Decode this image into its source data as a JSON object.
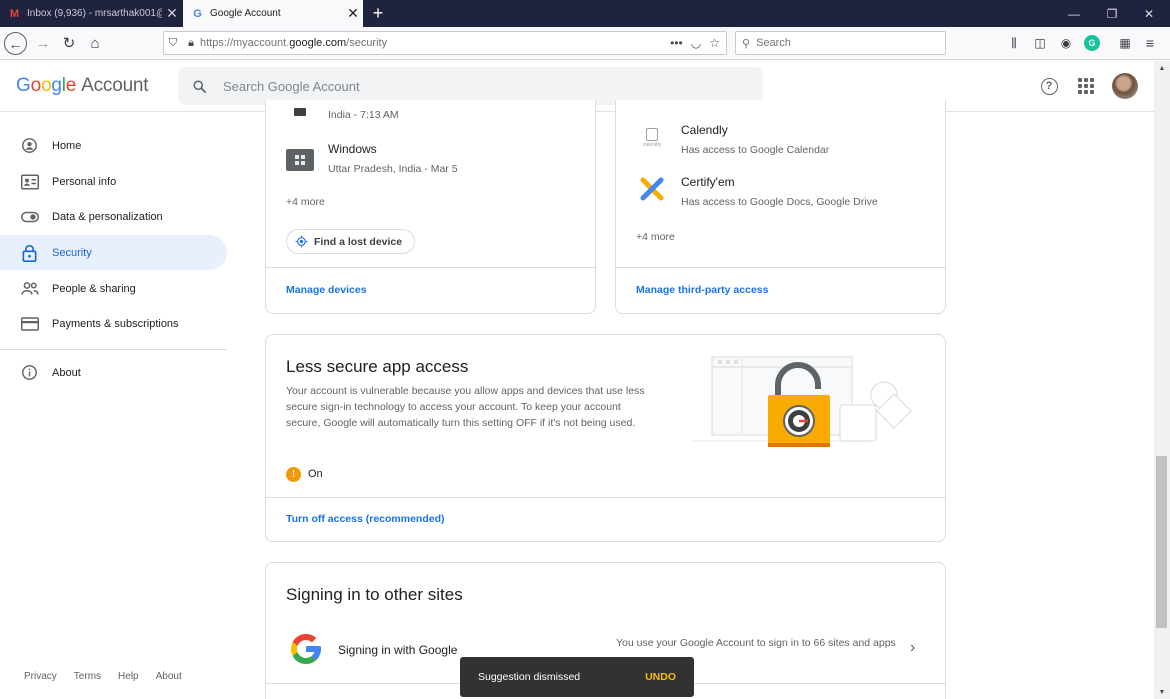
{
  "browser": {
    "tabs": [
      {
        "title": "Inbox (9,936) - mrsarthak001@",
        "icon": "gmail-icon"
      },
      {
        "title": "Google Account",
        "icon": "google-g-icon"
      }
    ],
    "url": {
      "prefix": "https://myaccount.",
      "host": "google.com",
      "path": "/security"
    },
    "search_placeholder": "Search"
  },
  "header": {
    "logo": {
      "g": "G",
      "o1": "o",
      "o2": "o",
      "g2": "g",
      "l": "l",
      "e": "e",
      "account": "Account"
    },
    "search_placeholder": "Search Google Account"
  },
  "sidebar": {
    "items": [
      {
        "label": "Home",
        "icon": "home-icon"
      },
      {
        "label": "Personal info",
        "icon": "personal-info-icon"
      },
      {
        "label": "Data & personalization",
        "icon": "toggle-icon"
      },
      {
        "label": "Security",
        "icon": "lock-icon"
      },
      {
        "label": "People & sharing",
        "icon": "people-icon"
      },
      {
        "label": "Payments & subscriptions",
        "icon": "card-icon"
      },
      {
        "label": "About",
        "icon": "info-icon"
      }
    ],
    "footer": [
      "Privacy",
      "Terms",
      "Help",
      "About"
    ]
  },
  "devices_card": {
    "partial_text": "India - 7:13 AM",
    "device": {
      "name": "Windows",
      "detail": "Uttar Pradesh, India - Mar 5"
    },
    "more": "+4 more",
    "find_button": "Find a lost device",
    "manage_link": "Manage devices"
  },
  "third_party_card": {
    "apps": [
      {
        "name": "Calendly",
        "detail": "Has access to Google Calendar"
      },
      {
        "name": "Certify'em",
        "detail": "Has access to Google Docs, Google Drive"
      }
    ],
    "more": "+4 more",
    "manage_link": "Manage third-party access"
  },
  "less_secure_card": {
    "title": "Less secure app access",
    "description": "Your account is vulnerable because you allow apps and devices that use less secure sign-in technology to access your account. To keep your account secure, Google will automatically turn this setting OFF if it's not being used.",
    "status": "On",
    "action_link": "Turn off access (recommended)",
    "colors": {
      "warning": "#f29900",
      "lock": "#f9ab00"
    }
  },
  "signing_card": {
    "title": "Signing in to other sites",
    "row_label": "Signing in with Google",
    "row_detail": "You use your Google Account to sign in to 66 sites and apps"
  },
  "snackbar": {
    "message": "Suggestion dismissed",
    "action": "UNDO"
  }
}
